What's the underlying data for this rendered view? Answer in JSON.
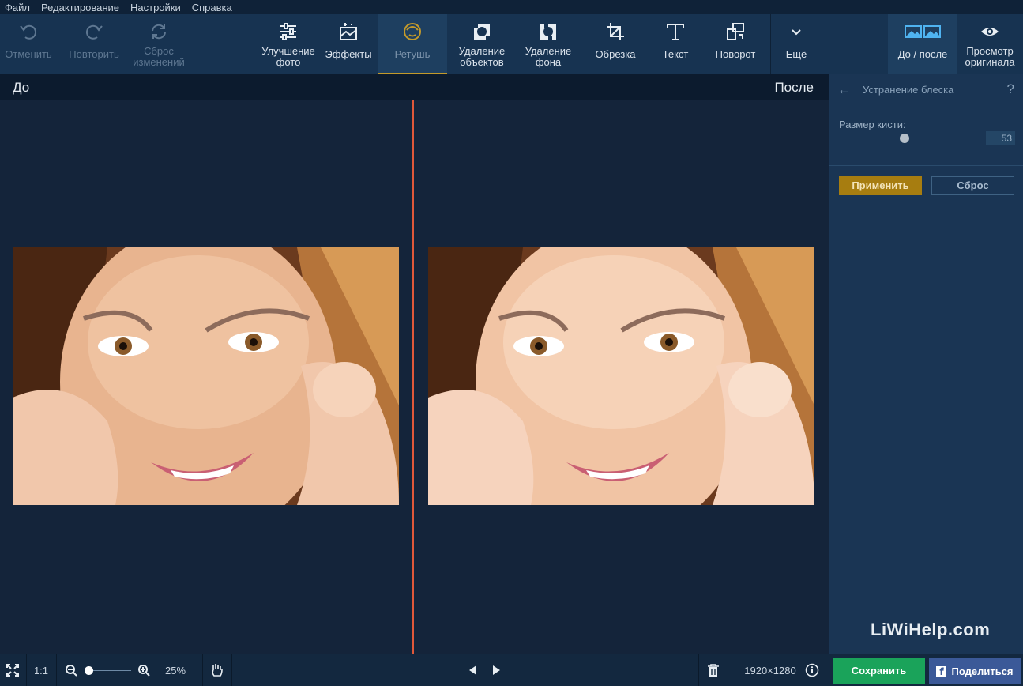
{
  "menu": [
    "Файл",
    "Редактирование",
    "Настройки",
    "Справка"
  ],
  "toolbar": {
    "undo": "Отменить",
    "redo": "Повторить",
    "reset_line1": "Сброс",
    "reset_line2": "изменений",
    "enhance_line1": "Улучшение",
    "enhance_line2": "фото",
    "effects": "Эффекты",
    "retouch": "Ретушь",
    "remove_objects_line1": "Удаление",
    "remove_objects_line2": "объектов",
    "remove_bg_line1": "Удаление",
    "remove_bg_line2": "фона",
    "crop": "Обрезка",
    "text": "Текст",
    "rotate": "Поворот",
    "more": "Ещё",
    "before_after": "До / после",
    "view_original_line1": "Просмотр",
    "view_original_line2": "оригинала"
  },
  "compare": {
    "before": "До",
    "after": "После"
  },
  "panel": {
    "title": "Устранение блеска",
    "help": "?",
    "brush_size_label": "Размер кисти:",
    "brush_size_value": "53",
    "brush_size_fraction": 0.5,
    "apply": "Применить",
    "reset": "Сброс"
  },
  "watermark": "LiWiHelp.com",
  "statusbar": {
    "actual_size": "1:1",
    "zoom": "25%",
    "dimensions": "1920×1280",
    "save": "Сохранить",
    "share": "Поделиться"
  },
  "colors": {
    "accent": "#c49a2a",
    "apply": "#a77d10",
    "save": "#1aa35a",
    "share": "#3b5998",
    "divider": "#e0583a"
  }
}
